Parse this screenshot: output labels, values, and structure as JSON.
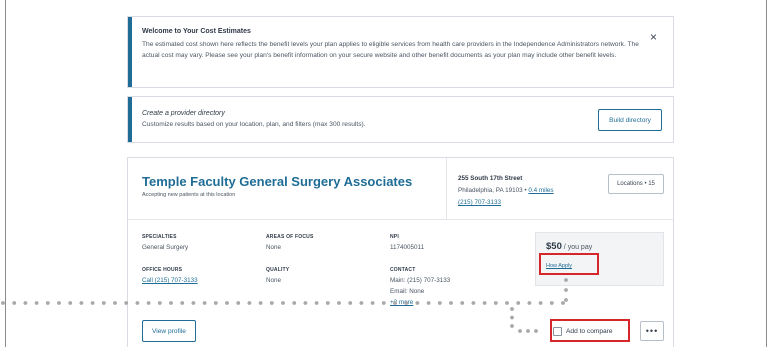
{
  "notice": {
    "title": "Welcome to Your Cost Estimates",
    "body": "The estimated cost shown here reflects the benefit levels your plan applies to eligible services from health care providers in the Independence Administrators network. The actual cost may vary. Please see your plan's benefit information on your secure website and other benefit documents as your plan may include other benefit levels.",
    "close_icon": "×"
  },
  "directory": {
    "title": "Create a provider directory",
    "body": "Customize results based on your location, plan, and filters (max 300 results).",
    "button": "Build directory"
  },
  "provider": {
    "name": "Temple Faculty General Surgery Associates",
    "accepting": "Accepting new patients at this location",
    "address": {
      "street": "255 South 17th Street",
      "city": "Philadelphia, PA 19103",
      "separator": " • ",
      "distance": "0.4 miles",
      "phone": "(215) 707-3133"
    },
    "locations_button": "Locations • 15",
    "details": {
      "specialties_label": "SPECIALTIES",
      "specialties_value": "General Surgery",
      "areas_label": "AREAS OF FOCUS",
      "areas_value": "None",
      "npi_label": "NPI",
      "npi_value": "1174005011",
      "hours_label": "OFFICE HOURS",
      "hours_value": "Call (215) 707-3133",
      "quality_label": "QUALITY",
      "quality_value": "None",
      "contact_label": "CONTACT",
      "contact_main": "Main: (215) 707-3133",
      "contact_email": "Email: None",
      "contact_more": "+2 more"
    },
    "cost": {
      "amount": "$50",
      "suffix": " / you pay",
      "how_applied": "How Apply"
    },
    "view_profile": "View profile",
    "add_to_compare": "Add to compare",
    "more_icon": "•••"
  },
  "colors": {
    "accent": "#1f6d96",
    "highlight": "#d4262b"
  }
}
